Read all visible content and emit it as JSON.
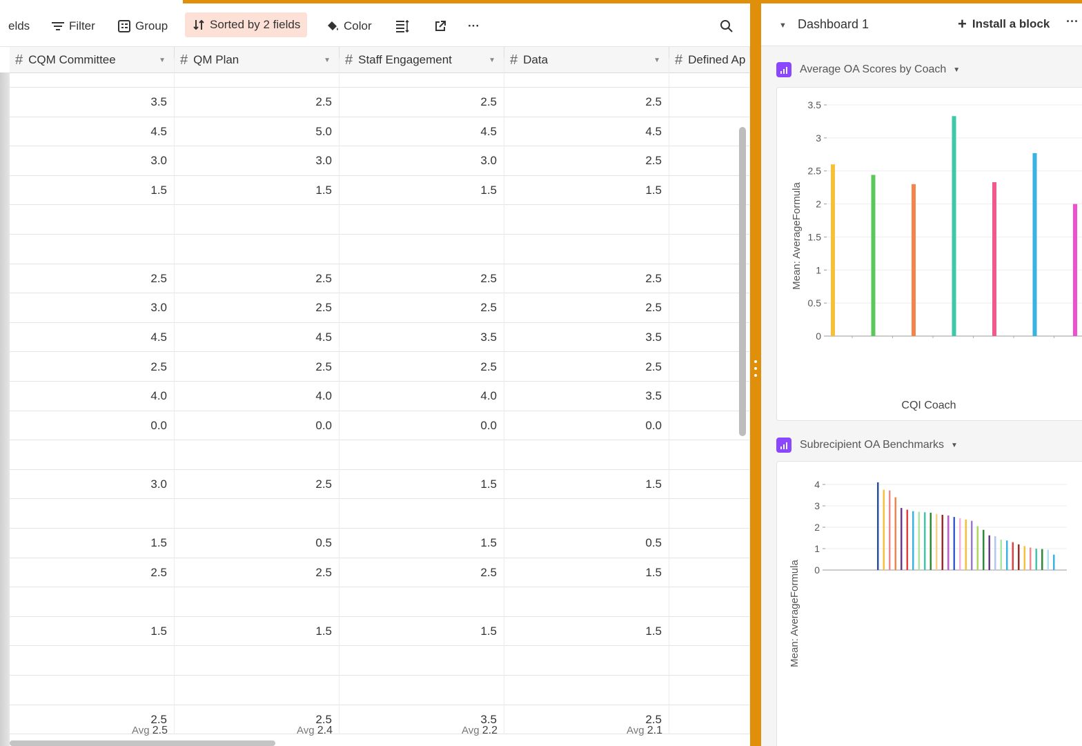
{
  "toolbar": {
    "fields_label": "elds",
    "filter_label": "Filter",
    "group_label": "Group",
    "sorted_label": "Sorted by 2 fields",
    "color_label": "Color",
    "row_height_icon": "row-height-icon",
    "share_icon": "share-icon",
    "more_label": "···",
    "search_icon": "search-icon"
  },
  "grid": {
    "columns": [
      {
        "name": "CQM Committee",
        "type_icon": "number-icon"
      },
      {
        "name": "QM Plan",
        "type_icon": "number-icon"
      },
      {
        "name": "Staff Engagement",
        "type_icon": "number-icon"
      },
      {
        "name": "Data",
        "type_icon": "number-icon"
      },
      {
        "name": "Defined Ap",
        "type_icon": "number-icon"
      }
    ],
    "rows": [
      [
        "",
        "",
        "",
        ""
      ],
      [
        "3.5",
        "2.5",
        "2.5",
        "2.5"
      ],
      [
        "4.5",
        "5.0",
        "4.5",
        "4.5"
      ],
      [
        "3.0",
        "3.0",
        "3.0",
        "2.5"
      ],
      [
        "1.5",
        "1.5",
        "1.5",
        "1.5"
      ],
      [
        "",
        "",
        "",
        ""
      ],
      [
        "",
        "",
        "",
        ""
      ],
      [
        "2.5",
        "2.5",
        "2.5",
        "2.5"
      ],
      [
        "3.0",
        "2.5",
        "2.5",
        "2.5"
      ],
      [
        "4.5",
        "4.5",
        "3.5",
        "3.5"
      ],
      [
        "2.5",
        "2.5",
        "2.5",
        "2.5"
      ],
      [
        "4.0",
        "4.0",
        "4.0",
        "3.5"
      ],
      [
        "0.0",
        "0.0",
        "0.0",
        "0.0"
      ],
      [
        "",
        "",
        "",
        ""
      ],
      [
        "3.0",
        "2.5",
        "1.5",
        "1.5"
      ],
      [
        "",
        "",
        "",
        ""
      ],
      [
        "1.5",
        "0.5",
        "1.5",
        "0.5"
      ],
      [
        "2.5",
        "2.5",
        "2.5",
        "1.5"
      ],
      [
        "",
        "",
        "",
        ""
      ],
      [
        "1.5",
        "1.5",
        "1.5",
        "1.5"
      ],
      [
        "",
        "",
        "",
        ""
      ],
      [
        "",
        "",
        "",
        ""
      ],
      [
        "2.5",
        "2.5",
        "3.5",
        "2.5"
      ]
    ],
    "summary": [
      {
        "label": "Avg",
        "value": "2.5"
      },
      {
        "label": "Avg",
        "value": "2.4"
      },
      {
        "label": "Avg",
        "value": "2.2"
      },
      {
        "label": "Avg",
        "value": "2.1"
      }
    ]
  },
  "dashboard": {
    "title": "Dashboard 1",
    "install_label": "Install a block",
    "more_label": "···",
    "accent_color": "#e08f0a",
    "block_icon_color": "#8b46ff"
  },
  "chart_data": [
    {
      "type": "bar",
      "title": "Average OA Scores by Coach",
      "xlabel": "CQI Coach",
      "ylabel": "Mean: AverageFormula",
      "ylim": [
        0,
        3.5
      ],
      "yticks": [
        "0",
        "0.5",
        "1",
        "1.5",
        "2",
        "2.5",
        "3",
        "3.5"
      ],
      "values": [
        2.6,
        2.44,
        2.3,
        3.33,
        2.33,
        2.77,
        2.0
      ],
      "colors": [
        "#f7c03a",
        "#5cc85c",
        "#f5844a",
        "#3ec8a8",
        "#f05a8a",
        "#3ab3e0",
        "#f050d0"
      ],
      "grid": true
    },
    {
      "type": "bar",
      "title": "Subrecipient OA Benchmarks",
      "ylabel": "Mean: AverageFormula",
      "ylim": [
        0,
        4
      ],
      "yticks": [
        "0",
        "1",
        "2",
        "3",
        "4"
      ],
      "values": [
        4.1,
        3.75,
        3.72,
        3.4,
        2.9,
        2.82,
        2.75,
        2.72,
        2.7,
        2.68,
        2.62,
        2.58,
        2.55,
        2.48,
        2.42,
        2.36,
        2.3,
        2.05,
        1.88,
        1.62,
        1.58,
        1.42,
        1.38,
        1.3,
        1.2,
        1.12,
        1.05,
        1.0,
        0.98,
        0.95,
        0.72
      ],
      "colors": [
        "#2b4f9e",
        "#f7c03a",
        "#f08a8a",
        "#f5844a",
        "#6a3a8a",
        "#e04040",
        "#3ab3e0",
        "#a8e6a0",
        "#3ec8a8",
        "#2e8a3a",
        "#f7d08a",
        "#9e2a2a",
        "#c05ad0",
        "#3a5ad0",
        "#f5b0e0",
        "#f7c03a",
        "#9a7ad0",
        "#a8d860",
        "#2e8a3a",
        "#6a3a8a",
        "#b0c8f0",
        "#a8e6a0",
        "#3ab3e0",
        "#e04040",
        "#9e2a2a",
        "#f7c03a",
        "#f08a8a",
        "#3ec8a8",
        "#2e8a3a",
        "#b0e0f0",
        "#3ab3e0"
      ],
      "grid": true
    }
  ]
}
